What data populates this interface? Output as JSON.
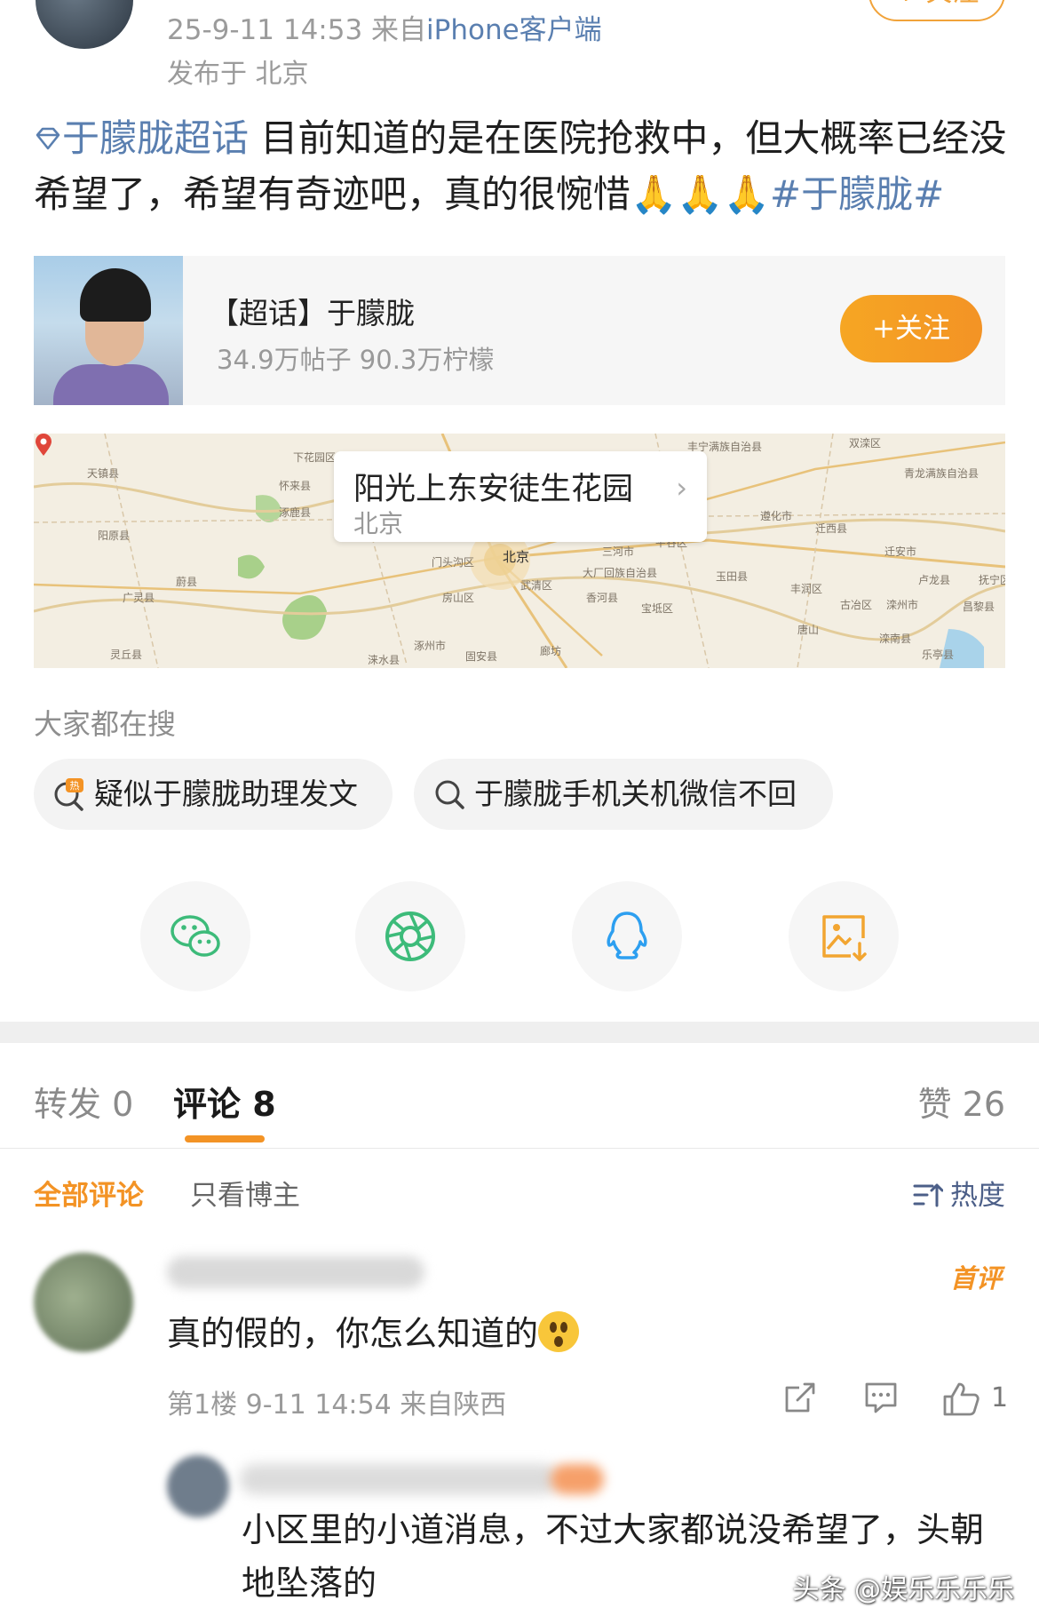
{
  "post": {
    "timestamp": "25-9-11 14:53",
    "source_prefix": "来自",
    "source": "iPhone客户端",
    "location": "发布于 北京",
    "follow_label": "+ 关注",
    "topic": "于朦胧超话",
    "body": " 目前知道的是在医院抢救中，但大概率已经没希望了，希望有奇迹吧，真的很惋惜",
    "emoji": "🙏🙏🙏",
    "hashtag": "#于朦胧#"
  },
  "supertopic_card": {
    "title": "【超话】于朦胧",
    "stats": "34.9万帖子 90.3万柠檬",
    "follow_label": "+关注"
  },
  "map": {
    "place": "阳光上东安徒生花园",
    "city": "北京",
    "labels": [
      "北京",
      "廊坊",
      "唐山",
      "三河市",
      "香河县",
      "宝坻区",
      "玉田县",
      "丰润区",
      "迁西县",
      "迁安市",
      "滦州市",
      "古冶区",
      "昌黎县",
      "乐亭县",
      "滦南县",
      "涿州市",
      "固安县",
      "蔚县",
      "广灵县",
      "涞水县",
      "怀来县",
      "涿鹿县",
      "天镇县",
      "阳原县",
      "丰宁满族自治县",
      "青龙满族自治县",
      "遵化市",
      "卢龙县",
      "抚宁区",
      "武清区",
      "门头沟区",
      "房山区",
      "大厂回族自治县",
      "下花园区",
      "灵丘县",
      "平谷区",
      "双滦区"
    ]
  },
  "trending": {
    "heading": "大家都在搜",
    "chips": [
      "疑似于朦胧助理发文",
      "于朦胧手机关机微信不回"
    ]
  },
  "share_icons": [
    "wechat-icon",
    "moments-icon",
    "qq-icon",
    "save-image-icon"
  ],
  "tabs": {
    "repost": "转发 0",
    "comments": "评论 8",
    "likes": "赞 26"
  },
  "filters": {
    "all": "全部评论",
    "author_only": "只看博主",
    "sort": "热度"
  },
  "comment": {
    "badge": "首评",
    "text": "真的假的，你怎么知道的",
    "meta": "第1楼  9-11 14:54  来自陕西",
    "like_count": "1"
  },
  "reply": {
    "text": "小区里的小道消息，不过大家都说没希望了，头朝地坠落的"
  },
  "watermark": "头条 @娱乐乐乐乐",
  "colors": {
    "accent_orange": "#f39325",
    "link_blue": "#5a7fb0",
    "wechat_green": "#3dbb7a",
    "qq_blue": "#2d9ff0",
    "save_orange": "#f2a531"
  }
}
